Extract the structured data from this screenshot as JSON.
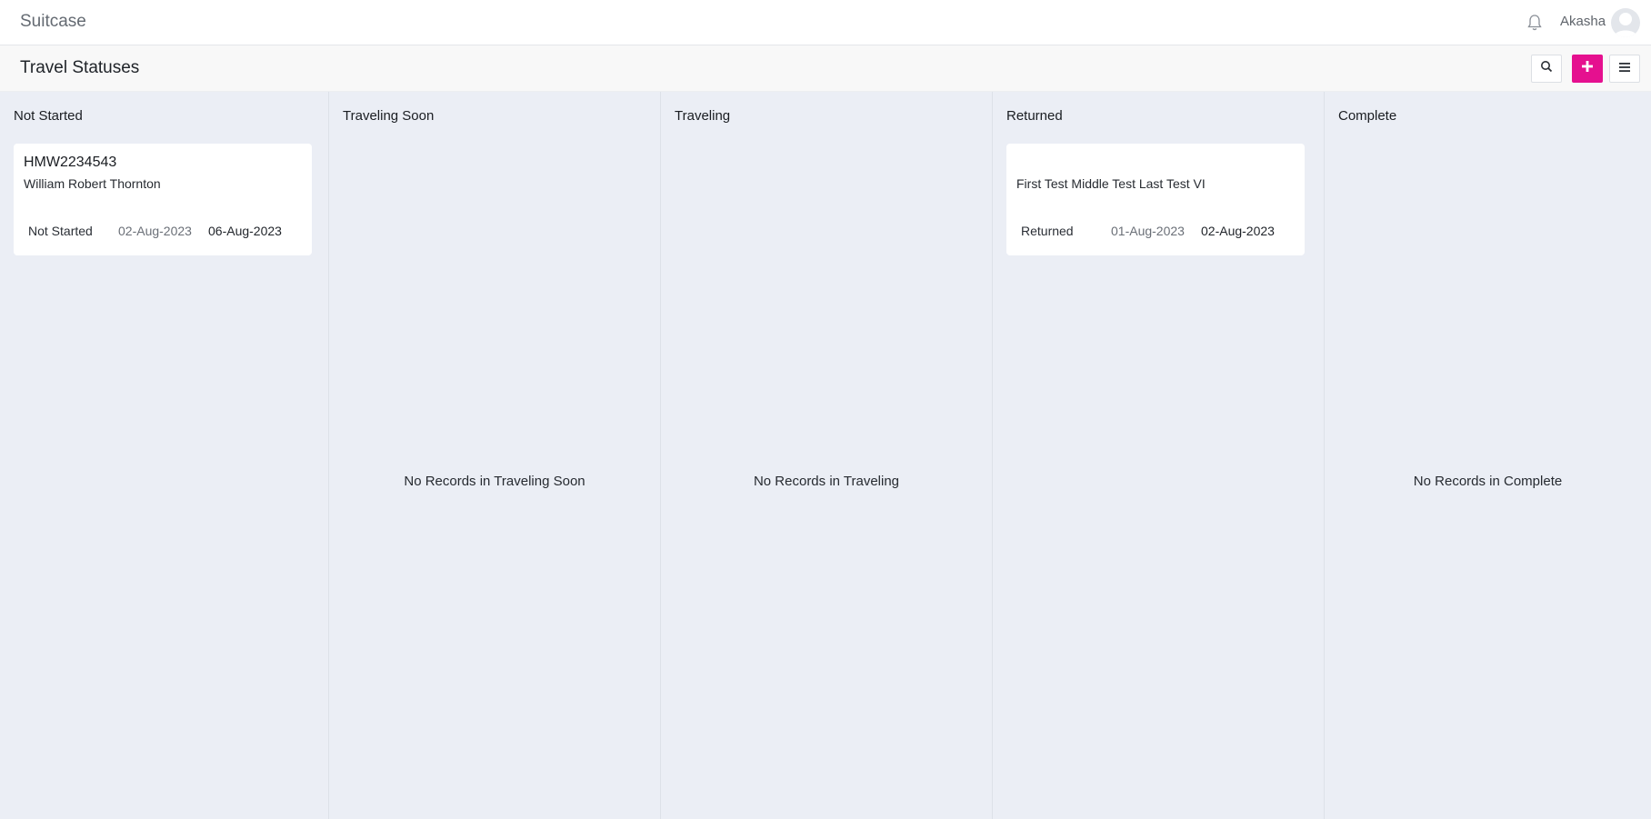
{
  "app": {
    "title": "Suitcase"
  },
  "user": {
    "name": "Akasha"
  },
  "header": {
    "title": "Travel Statuses"
  },
  "toolbar": {
    "search_icon": "search-icon",
    "add_icon": "plus-icon",
    "menu_icon": "hamburger-icon",
    "accent": "#e5108f"
  },
  "columns": [
    {
      "title": "Not Started",
      "empty": ""
    },
    {
      "title": "Traveling Soon",
      "empty": "No Records in Traveling Soon"
    },
    {
      "title": "Traveling",
      "empty": "No Records in Traveling"
    },
    {
      "title": "Returned",
      "empty": ""
    },
    {
      "title": "Complete",
      "empty": "No Records in Complete"
    }
  ],
  "cards": {
    "not_started": {
      "code": "HMW2234543",
      "name": "William Robert Thornton",
      "status": "Not Started",
      "start": "02-Aug-2023",
      "end": "06-Aug-2023"
    },
    "returned": {
      "code": "",
      "name": "First Test Middle Test Last Test VI",
      "status": "Returned",
      "start": "01-Aug-2023",
      "end": "02-Aug-2023"
    }
  }
}
